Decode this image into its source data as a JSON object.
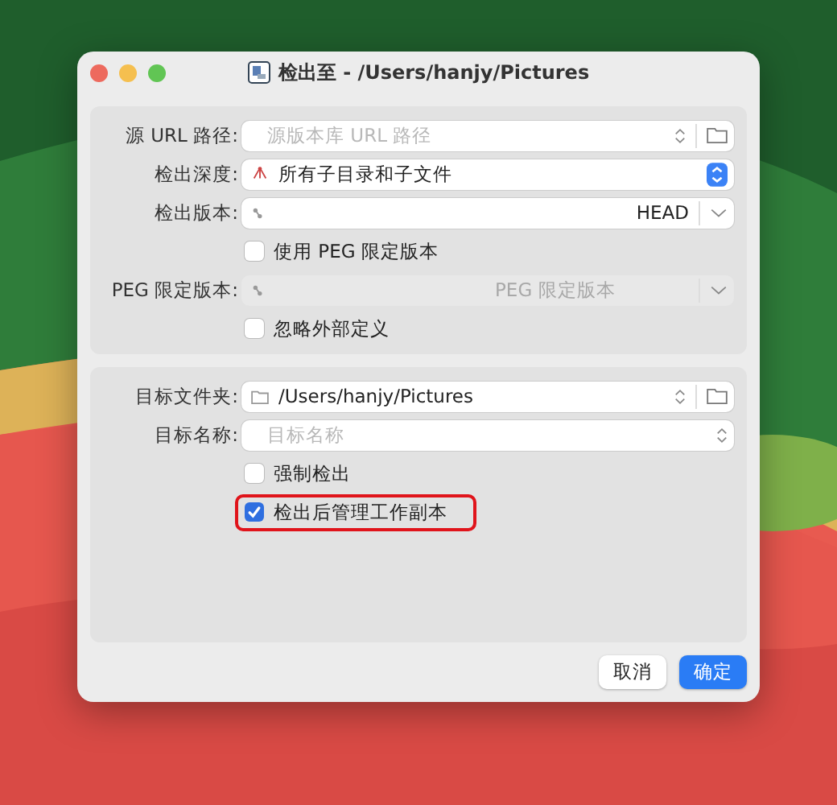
{
  "window": {
    "title": "检出至 - /Users/hanjy/Pictures"
  },
  "sections": [
    {
      "rows": [
        {
          "kind": "path",
          "label": "源 URL 路径:",
          "placeholder": "源版本库 URL 路径"
        },
        {
          "kind": "popup",
          "label": "检出深度:",
          "value": "所有子目录和子文件"
        },
        {
          "kind": "revision",
          "label": "检出版本:",
          "value": "HEAD",
          "disabled": false
        },
        {
          "kind": "checkbox",
          "text": "使用 PEG 限定版本",
          "checked": false,
          "highlighted": false
        },
        {
          "kind": "revision",
          "label": "PEG 限定版本:",
          "placeholder": "PEG 限定版本",
          "disabled": true
        },
        {
          "kind": "checkbox",
          "text": "忽略外部定义",
          "checked": false,
          "highlighted": false
        }
      ]
    },
    {
      "rows": [
        {
          "kind": "path",
          "label": "目标文件夹:",
          "value": "/Users/hanjy/Pictures"
        },
        {
          "kind": "combo",
          "label": "目标名称:",
          "placeholder": "目标名称"
        },
        {
          "kind": "checkbox",
          "text": "强制检出",
          "checked": false,
          "highlighted": false
        },
        {
          "kind": "checkbox",
          "text": "检出后管理工作副本",
          "checked": true,
          "highlighted": true
        }
      ]
    }
  ],
  "buttons": [
    {
      "label": "取消",
      "primary": false
    },
    {
      "label": "确定",
      "primary": true
    }
  ]
}
